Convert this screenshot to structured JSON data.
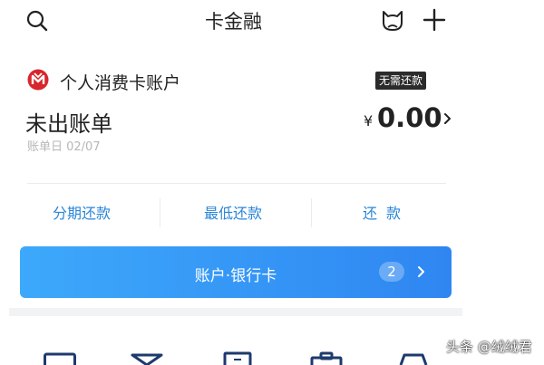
{
  "header": {
    "title": "卡金融"
  },
  "account": {
    "name": "个人消费卡账户",
    "badge": "无需还款",
    "bill_status": "未出账单",
    "currency": "¥",
    "amount": "0.00",
    "bill_date": "账单日 02/07"
  },
  "actions": {
    "installment": "分期还款",
    "minimum": "最低还款",
    "repay": "还款"
  },
  "cards_button": {
    "label": "账户·银行卡",
    "count": "2"
  },
  "bottom_icons": [
    "card-icon",
    "envelope-icon",
    "document-icon",
    "briefcase-icon",
    "cart-icon"
  ],
  "watermark": "头条 @绒绒君",
  "colors": {
    "accent_blue": "#2f86f1",
    "action_text": "#2b86d8",
    "brand_red": "#d7262c",
    "badge_bg": "#2b2b2b"
  }
}
